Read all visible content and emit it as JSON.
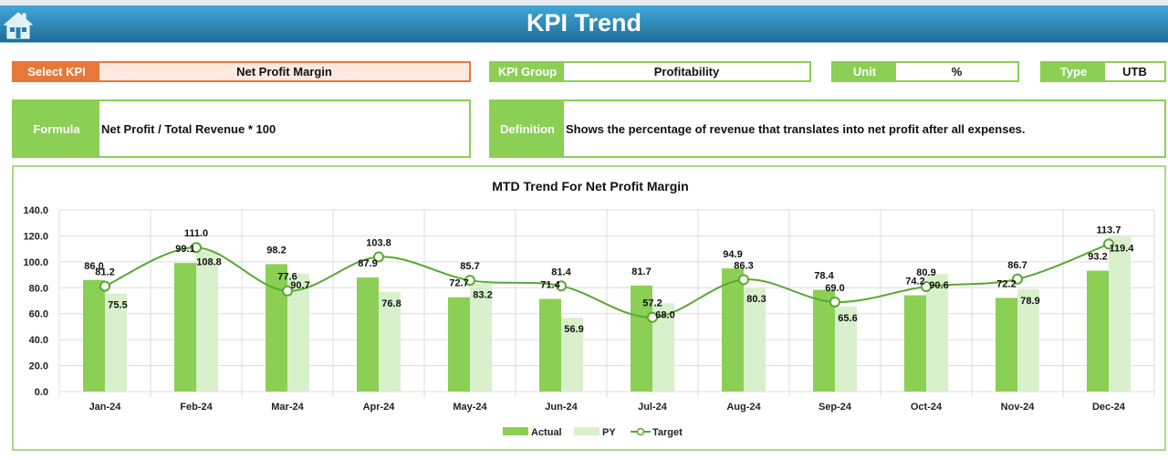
{
  "header": {
    "title": "KPI Trend",
    "home_icon": "home-icon"
  },
  "selectors": {
    "select_kpi": {
      "label": "Select KPI",
      "value": "Net Profit Margin"
    },
    "kpi_group": {
      "label": "KPI Group",
      "value": "Profitability"
    },
    "unit": {
      "label": "Unit",
      "value": "%"
    },
    "type": {
      "label": "Type",
      "value": "UTB"
    }
  },
  "formula": {
    "label": "Formula",
    "value": "Net Profit / Total Revenue * 100"
  },
  "definition": {
    "label": "Definition",
    "value": "Shows the percentage of revenue that translates into net profit after all expenses."
  },
  "colors": {
    "actual": "#8bcf55",
    "py": "#d8f0cc",
    "target": "#5aa832",
    "accent_orange": "#e8773a",
    "header_blue": "#2f8dbd"
  },
  "chart_data": {
    "type": "bar",
    "title": "MTD Trend For Net Profit Margin",
    "xlabel": "",
    "ylabel": "",
    "ylim": [
      0,
      140
    ],
    "yticks": [
      "0.0",
      "20.0",
      "40.0",
      "60.0",
      "80.0",
      "100.0",
      "120.0",
      "140.0"
    ],
    "grid": true,
    "legend_position": "bottom",
    "categories": [
      "Jan-24",
      "Feb-24",
      "Mar-24",
      "Apr-24",
      "May-24",
      "Jun-24",
      "Jul-24",
      "Aug-24",
      "Sep-24",
      "Oct-24",
      "Nov-24",
      "Dec-24"
    ],
    "series": [
      {
        "name": "Actual",
        "type": "bar",
        "values": [
          86.0,
          99.1,
          98.2,
          87.9,
          72.7,
          71.4,
          81.7,
          94.9,
          78.4,
          74.2,
          72.2,
          93.2
        ],
        "labels": [
          "86.0",
          "99.1",
          "98.2",
          "87.9",
          "72.7",
          "71.4",
          "81.7",
          "94.9",
          "78.4",
          "74.2",
          "72.2",
          "93.2"
        ]
      },
      {
        "name": "PY",
        "type": "bar",
        "values": [
          75.5,
          108.8,
          90.7,
          76.8,
          83.2,
          56.9,
          68.0,
          80.3,
          65.6,
          90.6,
          78.9,
          119.4
        ],
        "labels": [
          "75.5",
          "108.8",
          "90.7",
          "76.8",
          "83.2",
          "56.9",
          "68.0",
          "80.3",
          "65.6",
          "90.6",
          "78.9",
          "119.4"
        ]
      },
      {
        "name": "Target",
        "type": "line",
        "values": [
          81.2,
          111.0,
          77.6,
          103.8,
          85.7,
          81.4,
          57.2,
          86.3,
          69.0,
          80.9,
          86.7,
          113.7
        ],
        "labels": [
          "81.2",
          "111.0",
          "77.6",
          "103.8",
          "85.7",
          "81.4",
          "57.2",
          "86.3",
          "69.0",
          "80.9",
          "86.7",
          "113.7"
        ]
      }
    ]
  }
}
